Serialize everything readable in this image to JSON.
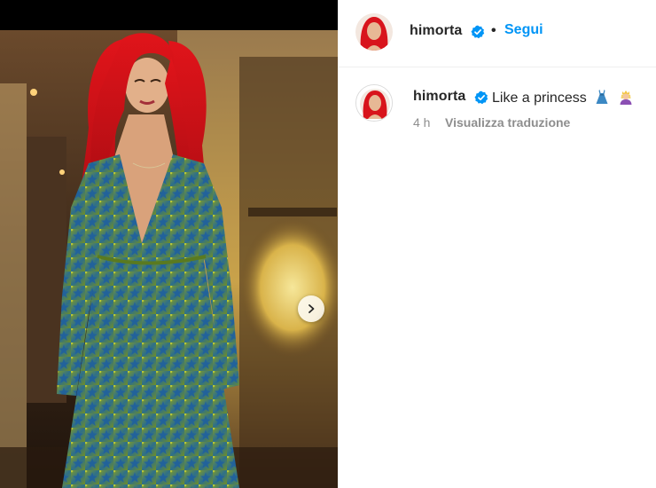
{
  "post": {
    "username": "himorta",
    "dot": "•",
    "follow_label": "Segui",
    "caption": "Like a princess",
    "emojis": [
      "dress-emoji",
      "princess-emoji"
    ],
    "time_ago": "4 h",
    "translate_label": "Visualizza traduzione"
  },
  "colors": {
    "accent_blue": "#0095f6",
    "text": "#262626",
    "muted": "#8e8e8e",
    "hair_red": "#d8141c",
    "dress_green": "#8ea32c",
    "dress_blue": "#1f5f9f"
  },
  "icons": [
    "verified-badge-icon",
    "chevron-right-icon"
  ]
}
